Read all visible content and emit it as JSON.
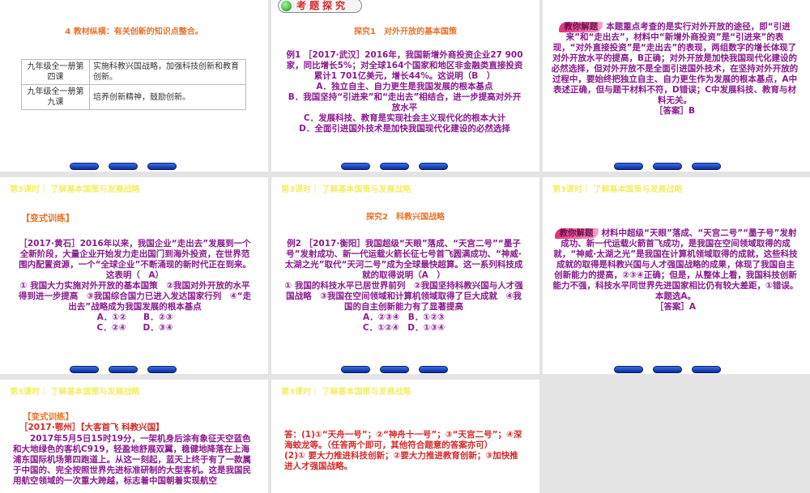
{
  "header": "第3课时｜ 了解基本国策与发展战略",
  "s1": {
    "title": "4 教材纵横：有关创新的知识点整合。",
    "rows": [
      [
        "九年级全一册第四课",
        "实施科教兴国战略，加强科技创新和教育创新。"
      ],
      [
        "九年级全一册第九课",
        "培养创新精神，鼓励创新。"
      ]
    ]
  },
  "s2": {
    "banner": "考题探究",
    "title": "探究1　对外开放的基本国策",
    "lines": [
      "例1 ［2017·武汉］2016年，我国新增外商投资企业27 900家，同比增长5%；对全球164个国家和地区非金融类直接投资累计1 701亿美元，增长44%。这说明（B　）",
      "A．独立自主、自力更生是我国发展的根本基点",
      "B．我国坚持“引进来”和“走出去”相结合，进一步提高对外开放水平",
      "C．发展科技、教育是实现社会主义现代化的根本大计",
      "D．全面引进国外技术是加快我国现代化建设的必然选择"
    ]
  },
  "s3": {
    "badge": "教你解题",
    "text": "本题重点考查的是实行对外开放的途径，即“引进来”和“走出去”，材料中“新增外商投资”是“引进来”的表现，“对外直接投资”是“走出去”的表现，两组数字的增长体现了对外开放水平的提高，B正确；对外开放是加快我国现代化建设的必然选择，但对外开放不是全面引进国外技术，在坚持对外开放的过程中，要始终把独立自主、自力更生作为发展的根本基点，A中表述正确，但与题干材料不符，D错误；C中发展科技、教育与材料无关。",
    "answer": "［答案］B"
  },
  "s4": {
    "title": "【变式训练】",
    "lines": [
      "［2017·黄石］2016年以来，我国企业“走出去”发展到一个全新阶段，大量企业开始发力走出国门到海外投资，在世界范围内配置资源，一个“全球企业”不断涌现的新时代正在到来。这表明（　A）",
      "① 我国大力实施对外开放的基本国策　②我国对外开放的水平得到进一步提高　③我国综合国力已进入发达国家行列　④“走出去”战略成为我国发展的根本基点",
      "A．①②　　B．②③",
      "C．②④　　D．③④"
    ]
  },
  "s5": {
    "title": "探究2　科教兴国战略",
    "lines": [
      "例2 ［2017·衡阳］我国超级“天眼”落成、“天宫二号”“墨子号”发射成功、新一代运载火箭长征七号首飞圆满成功、“神威·太湖之光”取代“天河二号”成为全球最快超算。这一系列科技成就的取得说明（A　）",
      "① 我国的科技水平已居世界前列　②我国坚持科教兴国与人才强国战略　③我国在空间领域和计算机领域取得了巨大成就　④我国的自主创新能力有了显著提高",
      "A．②③④　B．①②③",
      "C．①②④　D．①③④"
    ]
  },
  "s6": {
    "badge": "教你解题",
    "text": "材料中超级“天眼”落成、“天宫二号”“墨子号”发射成功、新一代运载火箭首飞成功，是我国在空间领域取得的成就，“神威·太湖之光”是我国在计算机领域取得的成就，这些科技成就的取得是科教兴国与人才强国战略的成果，体现了我国自主创新能力的提高，②③④正确；但是，从整体上看，我国科技创新能力不强，科技水平同世界先进国家相比仍有较大差距，①错误。本题选A。",
    "answer": "［答案］A"
  },
  "s7": {
    "title": "【变式训练】",
    "source": "［2017·鄂州］【大客首飞 科教兴国】",
    "text": "2017年5月5日15时19分，一架机身后涂有象征天空蓝色和大地绿色的客机C919，轻盈地舒展双翼，稳健地降落在上海浦东国际机场第四跑道上。从这一刻起，蓝天上终于有了一款属于中国的、完全按照世界先进标准研制的大型客机。这是我国民用航空领域的一次重大跨越，标志着中国朝着实现航空"
  },
  "s8": {
    "a1": "答：(1)①“天舟一号”；②“神舟十一号”；③“天宫二号”；④深海蛟龙等。（任答两个即可，其他符合题意的答案亦可）",
    "a2": "(2)① 要大力推进科技创新；②要大力推进教育创新；③加快推进人才强国战略。"
  }
}
